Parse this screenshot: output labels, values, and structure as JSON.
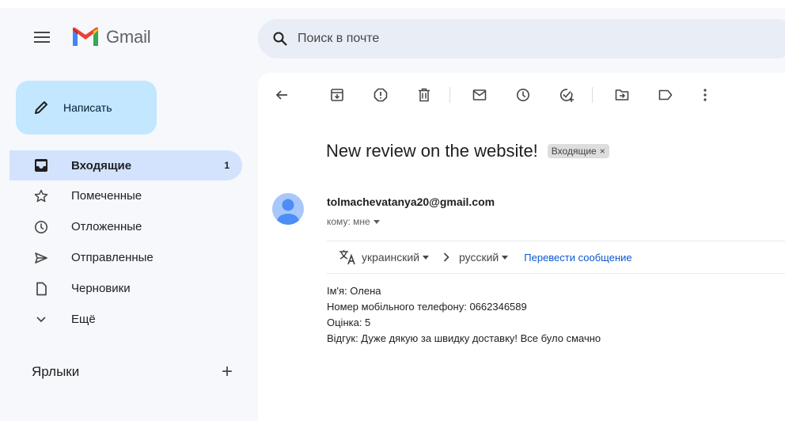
{
  "app": {
    "name": "Gmail"
  },
  "search": {
    "placeholder": "Поиск в почте"
  },
  "compose": {
    "label": "Написать"
  },
  "sidebar": {
    "items": [
      {
        "label": "Входящие",
        "count": "1"
      },
      {
        "label": "Помеченные"
      },
      {
        "label": "Отложенные"
      },
      {
        "label": "Отправленные"
      },
      {
        "label": "Черновики"
      },
      {
        "label": "Ещё"
      }
    ],
    "labels_title": "Ярлыки",
    "labels_add": "+"
  },
  "message": {
    "subject": "New review on the website!",
    "label_chip": "Входящие",
    "label_chip_close": "×",
    "sender": "tolmachevatanya20@gmail.com",
    "recipient": "кому: мне",
    "translate": {
      "from": "украинский",
      "to": "русский",
      "action": "Перевести сообщение"
    },
    "body_lines": [
      "Ім'я: Олена",
      "Номер мобільного телефону: 0662346589",
      "Оцінка: 5",
      "Відгук: Дуже дякую за швидку доставку! Все було смачно"
    ]
  },
  "colors": {
    "background": "#f6f8fc",
    "compose": "#c2e7ff",
    "active_nav": "#d3e3fd",
    "search": "#e9eef6",
    "link": "#0b57d0"
  },
  "icons": [
    "menu-icon",
    "gmail-logo-icon",
    "search-icon",
    "pencil-icon",
    "inbox-icon",
    "star-icon",
    "clock-icon",
    "send-icon",
    "draft-icon",
    "chevron-down-icon",
    "back-arrow-icon",
    "archive-icon",
    "report-spam-icon",
    "delete-icon",
    "mark-unread-icon",
    "snooze-icon",
    "add-task-icon",
    "move-to-icon",
    "label-icon",
    "more-vert-icon",
    "avatar-icon",
    "translate-icon"
  ]
}
